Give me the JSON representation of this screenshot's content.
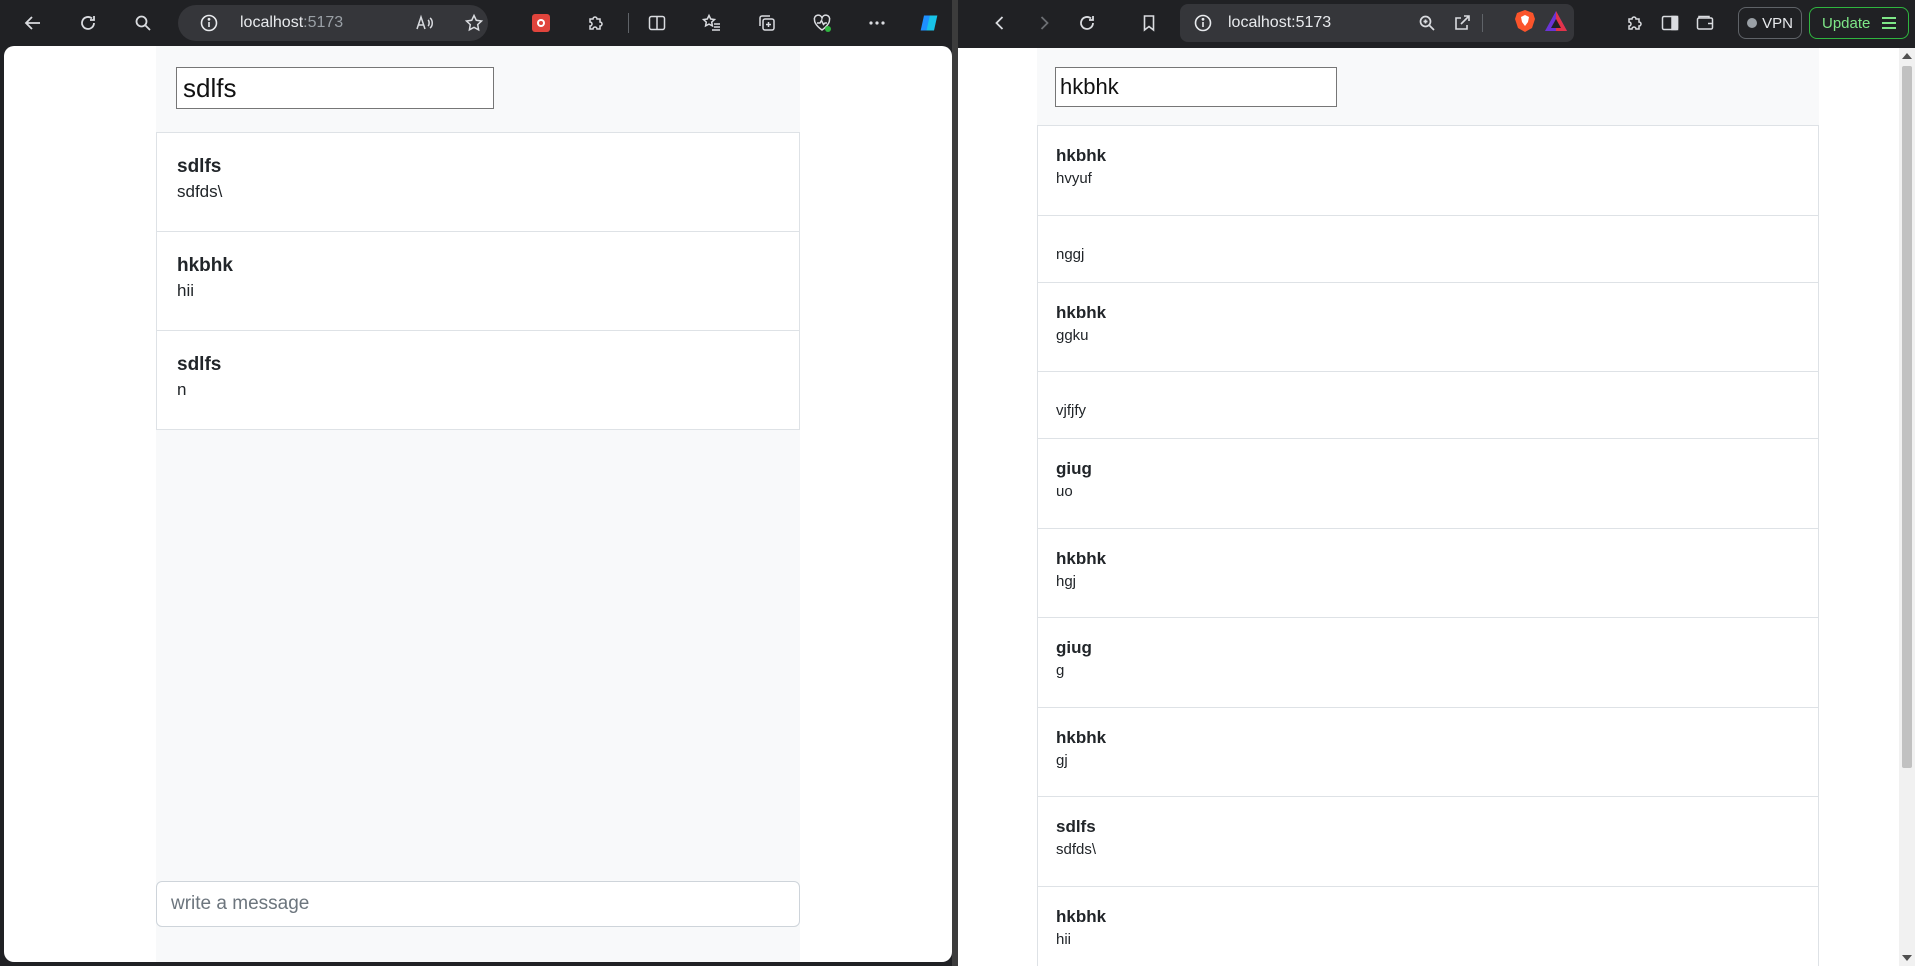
{
  "left_browser": {
    "address": {
      "host": "localhost",
      "port": ":5173"
    },
    "icons": [
      "back-icon",
      "refresh-icon",
      "search-icon",
      "info-icon",
      "read-aloud-icon",
      "favorite-star-icon",
      "extension-red-icon",
      "extensions-puzzle-icon",
      "split-screen-icon",
      "favorites-icon",
      "collections-icon",
      "browser-essentials-icon",
      "more-icon",
      "copilot-icon"
    ],
    "app": {
      "name_input_value": "sdlfs",
      "messages": [
        {
          "name": "sdlfs",
          "text": "sdfds\\"
        },
        {
          "name": "hkbhk",
          "text": "hii"
        },
        {
          "name": "sdlfs",
          "text": "n"
        }
      ],
      "message_placeholder": "write a message"
    }
  },
  "right_browser": {
    "address": {
      "host": "localhost",
      "port": ":5173"
    },
    "icons": [
      "back-icon",
      "forward-icon",
      "reload-icon",
      "bookmark-icon",
      "info-icon",
      "zoom-icon",
      "share-icon",
      "brave-shields-icon",
      "brave-rewards-icon",
      "extensions-icon",
      "sidebar-icon",
      "wallet-icon"
    ],
    "vpn_label": "VPN",
    "update_label": "Update",
    "app": {
      "name_input_value": "hkbhk",
      "messages": [
        {
          "name": "hkbhk",
          "text": "hvyuf"
        },
        {
          "name": "",
          "text": "nggj"
        },
        {
          "name": "hkbhk",
          "text": "ggku"
        },
        {
          "name": "",
          "text": "vjfjfy"
        },
        {
          "name": "giug",
          "text": "uo"
        },
        {
          "name": "hkbhk",
          "text": "hgj"
        },
        {
          "name": "giug",
          "text": "g"
        },
        {
          "name": "hkbhk",
          "text": "gj"
        },
        {
          "name": "sdlfs",
          "text": "sdfds\\"
        },
        {
          "name": "hkbhk",
          "text": "hii"
        }
      ]
    }
  },
  "colors": {
    "toolbar_bg": "#202124",
    "app_bg": "#f8f9fa",
    "border": "#dee2e6",
    "update_green": "#2fb53f"
  }
}
